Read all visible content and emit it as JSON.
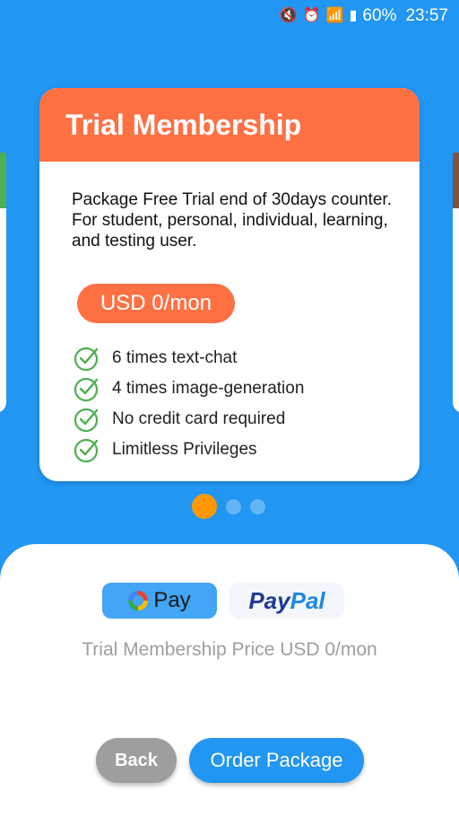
{
  "status_bar": {
    "battery": "60%",
    "time": "23:57",
    "icons": [
      "mute-icon",
      "alarm-icon",
      "wifi-icon",
      "sim-icon",
      "signal-icon",
      "signal-icon",
      "battery-icon"
    ]
  },
  "card": {
    "title": "Trial Membership",
    "description": "Package Free Trial end of 30days counter. For student, personal, individual, learning, and testing user.",
    "price": "USD 0/mon",
    "features": [
      "6 times text-chat",
      "4 times image-generation",
      "No credit card required",
      "Limitless Privileges"
    ],
    "accent_color": "#ff7043"
  },
  "pager": {
    "count": 3,
    "active_index": 0
  },
  "payment": {
    "gpay_label": "Pay",
    "paypal_label_1": "Pay",
    "paypal_label_2": "Pal",
    "price_caption": "Trial Membership Price USD 0/mon"
  },
  "actions": {
    "back_label": "Back",
    "order_label": "Order Package"
  },
  "colors": {
    "background": "#2196f3",
    "primary_button": "#2196f3",
    "back_button": "#9e9e9e",
    "active_dot": "#ff9800"
  }
}
